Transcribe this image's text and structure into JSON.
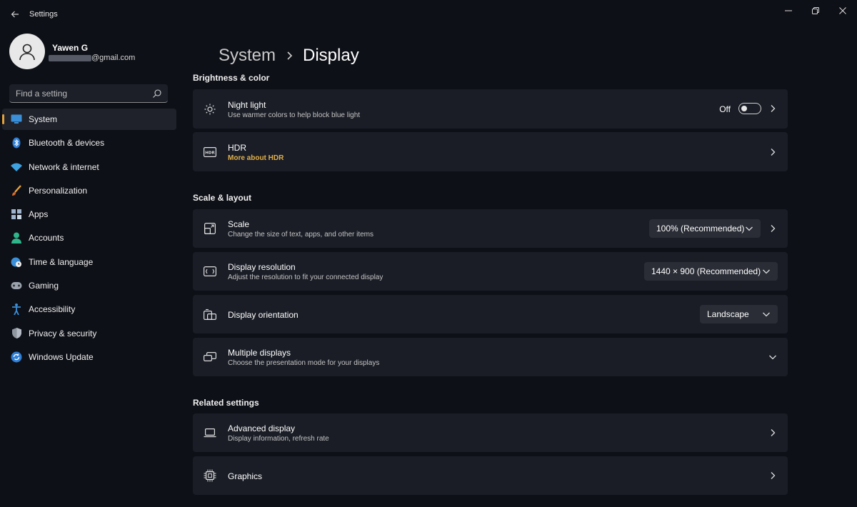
{
  "window": {
    "title": "Settings"
  },
  "profile": {
    "name": "Yawen G",
    "email_suffix": "@gmail.com"
  },
  "search": {
    "placeholder": "Find a setting"
  },
  "sidebar": {
    "items": [
      {
        "label": "System",
        "icon": "monitor-icon"
      },
      {
        "label": "Bluetooth & devices",
        "icon": "bluetooth-icon"
      },
      {
        "label": "Network & internet",
        "icon": "wifi-icon"
      },
      {
        "label": "Personalization",
        "icon": "brush-icon"
      },
      {
        "label": "Apps",
        "icon": "apps-icon"
      },
      {
        "label": "Accounts",
        "icon": "person-icon"
      },
      {
        "label": "Time & language",
        "icon": "globe-clock-icon"
      },
      {
        "label": "Gaming",
        "icon": "gamepad-icon"
      },
      {
        "label": "Accessibility",
        "icon": "accessibility-icon"
      },
      {
        "label": "Privacy & security",
        "icon": "shield-icon"
      },
      {
        "label": "Windows Update",
        "icon": "update-icon"
      }
    ],
    "active_index": 0
  },
  "breadcrumb": {
    "parent": "System",
    "current": "Display"
  },
  "sections": {
    "brightness": "Brightness & color",
    "scale_layout": "Scale & layout",
    "related": "Related settings"
  },
  "night_light": {
    "title": "Night light",
    "subtitle": "Use warmer colors to help block blue light",
    "state_label": "Off",
    "on": false
  },
  "hdr": {
    "title": "HDR",
    "link": "More about HDR"
  },
  "scale": {
    "title": "Scale",
    "subtitle": "Change the size of text, apps, and other items",
    "value": "100% (Recommended)"
  },
  "resolution": {
    "title": "Display resolution",
    "subtitle": "Adjust the resolution to fit your connected display",
    "value": "1440 × 900 (Recommended)"
  },
  "orientation": {
    "title": "Display orientation",
    "value": "Landscape"
  },
  "multiple_displays": {
    "title": "Multiple displays",
    "subtitle": "Choose the presentation mode for your displays"
  },
  "advanced_display": {
    "title": "Advanced display",
    "subtitle": "Display information, refresh rate"
  },
  "graphics": {
    "title": "Graphics"
  },
  "colors": {
    "background": "#0e1017",
    "card": "#1a1d26",
    "accent": "#e3a23c",
    "link": "#e2b04a"
  }
}
